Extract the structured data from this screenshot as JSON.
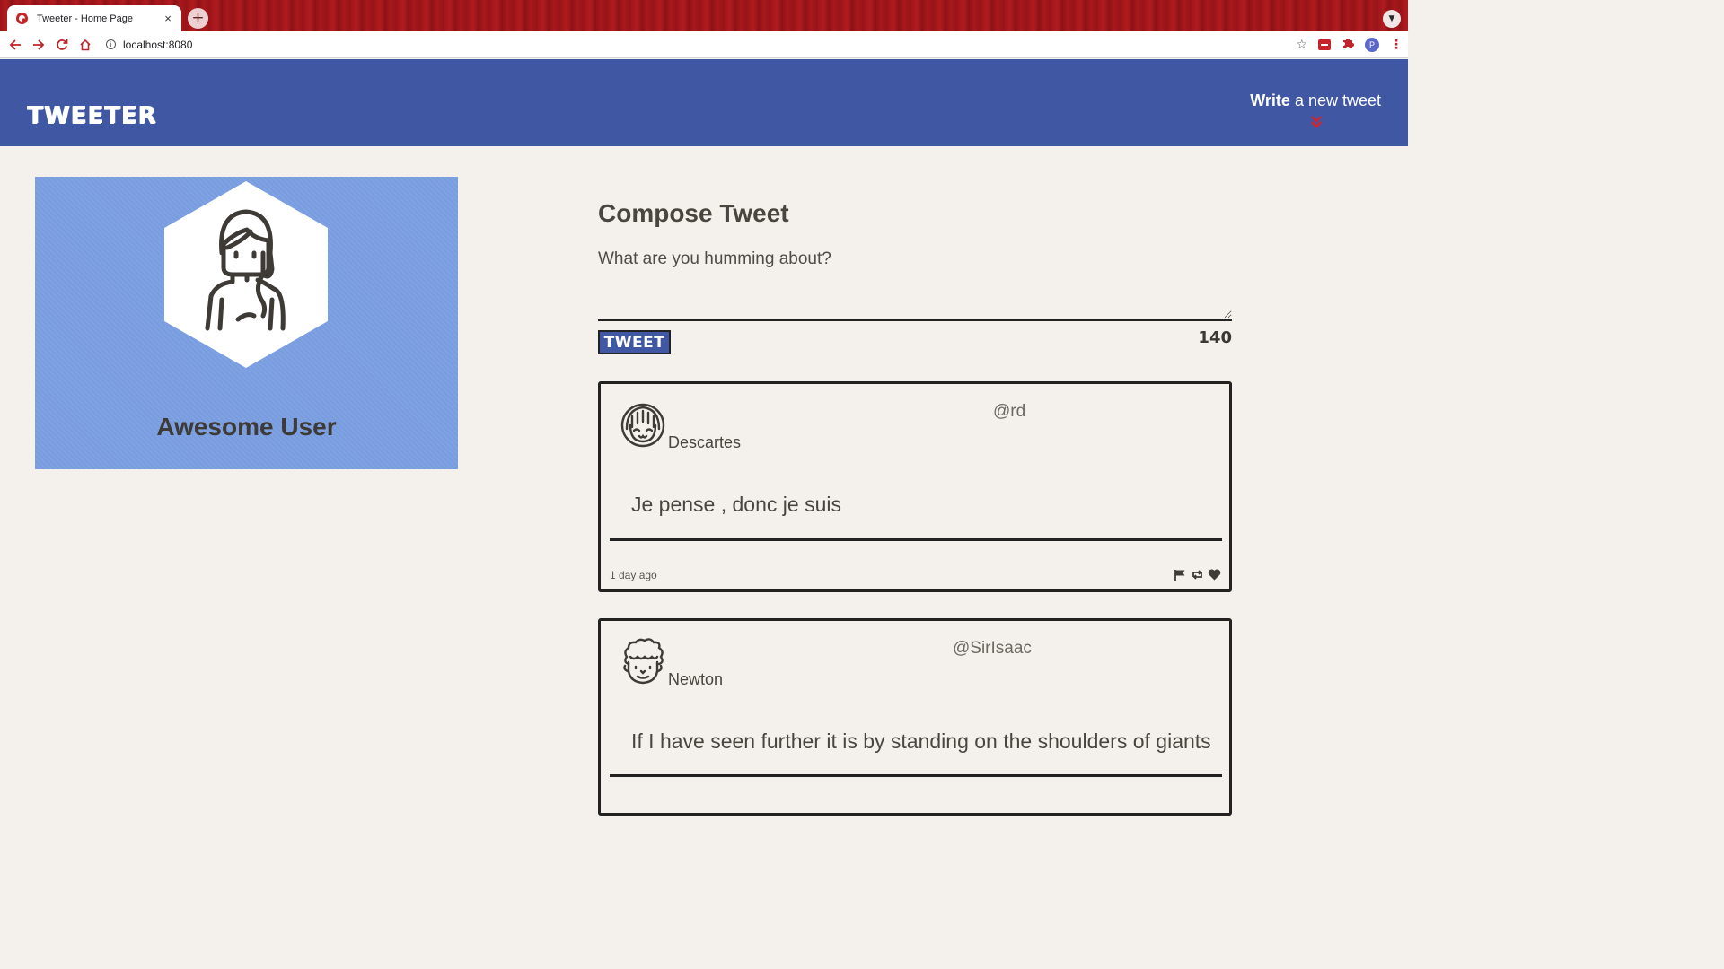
{
  "browser": {
    "tab_title": "Tweeter - Home Page",
    "tab_close": "×",
    "new_tab": "+",
    "url": "localhost:8080",
    "profile_initial": "P"
  },
  "nav": {
    "brand": "TWEETER",
    "write_bold": "Write",
    "write_rest": " a new tweet"
  },
  "profile": {
    "name": "Awesome User"
  },
  "compose": {
    "title": "Compose Tweet",
    "placeholder": "What are you humming about?",
    "button_label": "TWEET",
    "counter": "140"
  },
  "tweets": [
    {
      "name": "Descartes",
      "handle": "@rd",
      "content": "Je pense , donc je suis",
      "time": "1 day ago"
    },
    {
      "name": "Newton",
      "handle": "@SirIsaac",
      "content": "If I have seen further it is by standing on the shoulders of giants"
    }
  ],
  "colors": {
    "nav_bg": "#4057a4",
    "page_bg": "#f4f1ec",
    "profile_bg": "#7b9fe2",
    "accent_red": "#c8232a",
    "text_dark": "#4a453f"
  },
  "icons": {
    "flag": "flag-icon",
    "retweet": "retweet-icon",
    "heart": "heart-icon",
    "chevron": "double-chevron-down-icon"
  }
}
